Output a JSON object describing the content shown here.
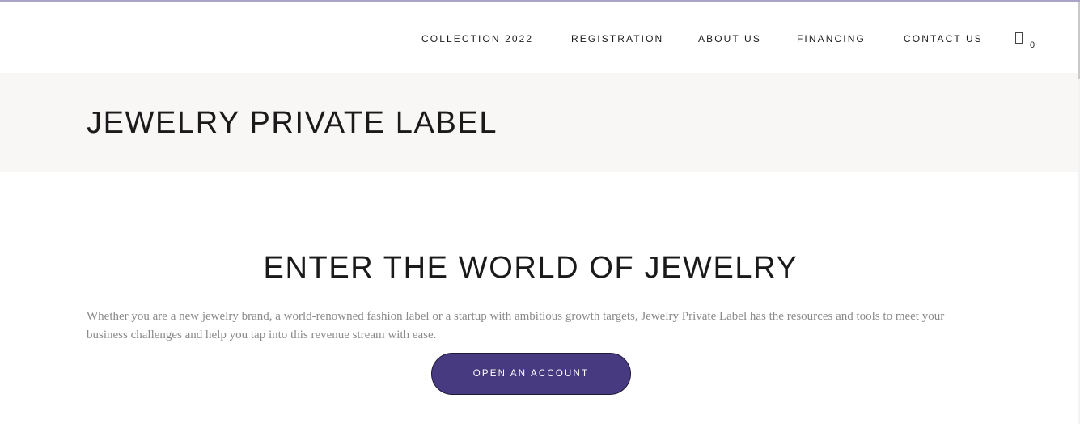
{
  "nav": {
    "items": [
      {
        "label": "COLLECTION 2022"
      },
      {
        "label": "REGISTRATION"
      },
      {
        "label": "ABOUT US"
      },
      {
        "label": "FINANCING"
      },
      {
        "label": "CONTACT US"
      }
    ],
    "cart": {
      "icon": "cart-icon",
      "count": "0"
    }
  },
  "page": {
    "title": "JEWELRY PRIVATE LABEL"
  },
  "intro": {
    "heading": "ENTER THE WORLD OF JEWELRY",
    "body": "Whether you are a new jewelry brand, a world-renowned fashion label or a startup with ambitious growth targets, Jewelry Private Label has the resources and tools to meet your business challenges and help you tap into this revenue stream with ease.",
    "cta_label": "OPEN AN ACCOUNT"
  },
  "colors": {
    "accent": "#483a80",
    "title_band": "#f9f6f6",
    "top_border": "#a9a3c8"
  }
}
